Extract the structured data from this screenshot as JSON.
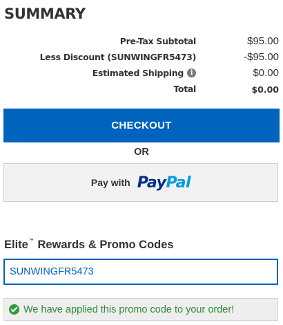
{
  "summary": {
    "title": "SUMMARY",
    "rows": [
      {
        "label": "Pre-Tax Subtotal",
        "value": "$95.00"
      },
      {
        "label": "Less Discount (SUNWINGFR5473)",
        "value": "-$95.00"
      },
      {
        "label": "Estimated Shipping",
        "value": "$0.00",
        "icon": "info-icon"
      },
      {
        "label": "Total",
        "value": "$0.00"
      }
    ]
  },
  "checkout": {
    "label": "CHECKOUT",
    "color": "#0063be"
  },
  "or_label": "OR",
  "paypal": {
    "prefix": "Pay with",
    "logo_pay": "Pay",
    "logo_pal": "Pal",
    "colors": {
      "pay": "#003087",
      "pal": "#009cde"
    }
  },
  "promo": {
    "heading_brand": "Elite",
    "heading_tm": "™",
    "heading_rest": "Rewards & Promo Codes",
    "input_value": "SUNWINGFR5473",
    "success_icon": "check-circle-icon",
    "success_message": "We have applied this promo code to your order!",
    "success_color": "#2e8b3a"
  }
}
